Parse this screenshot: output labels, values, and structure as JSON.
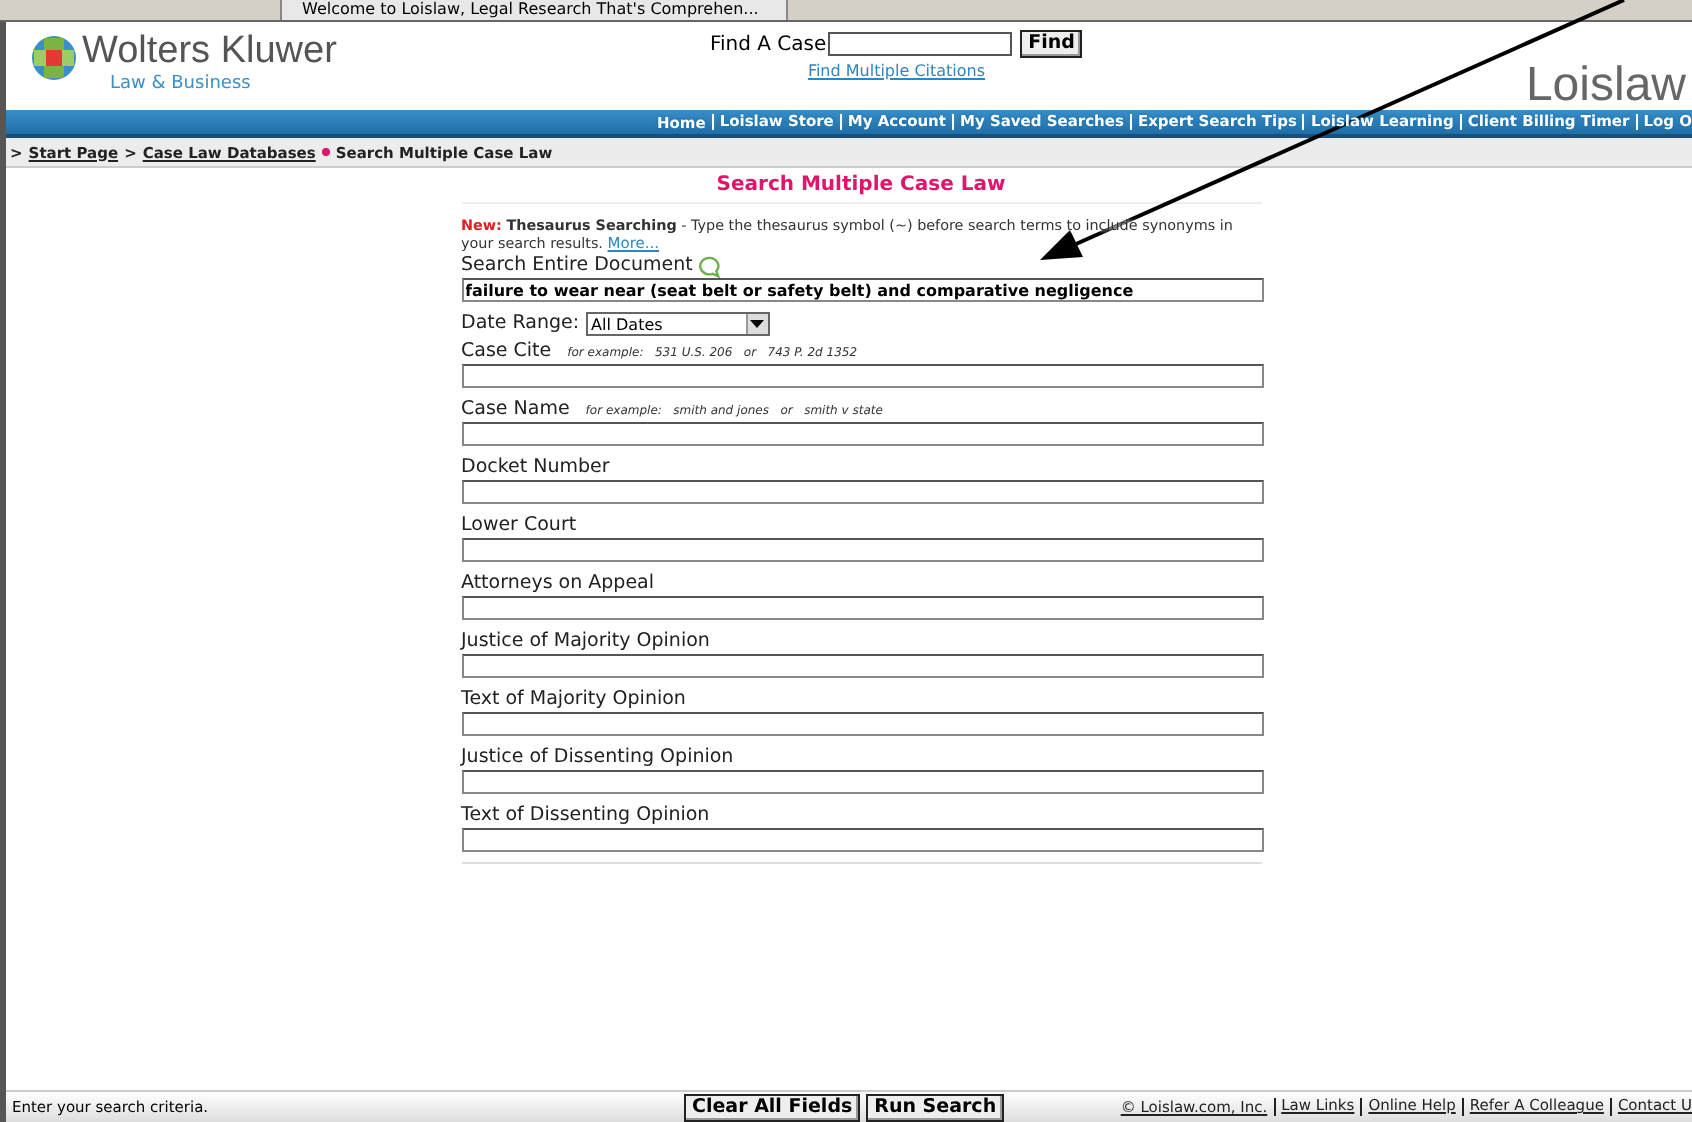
{
  "browser_tab": {
    "title": "Welcome to Loislaw, Legal Research That's Comprehen..."
  },
  "header": {
    "logo_name": "Wolters Kluwer",
    "logo_sub": "Law & Business",
    "find_label": "Find A Case",
    "find_button": "Find",
    "find_multiple": "Find Multiple Citations",
    "brand": "Loislaw"
  },
  "nav": [
    "Home",
    "Loislaw Store",
    "My Account",
    "My Saved Searches",
    "Expert Search Tips",
    "Loislaw Learning",
    "Client Billing Timer",
    "Log O"
  ],
  "breadcrumb": {
    "prefix": ">",
    "links": [
      "Start Page",
      "Case Law Databases"
    ],
    "current": "Search Multiple Case Law"
  },
  "page_title": "Search Multiple Case Law",
  "notice": {
    "new": "New:",
    "title": "Thesaurus Searching",
    "text": " - Type the thesaurus symbol (~) before search terms to include synonyms in your search results.",
    "more": "More..."
  },
  "fields": [
    {
      "kind": "text",
      "label": "Search Entire Document",
      "help_icon": true,
      "value": "failure to wear near (seat belt or safety belt) and comparative negligence"
    },
    {
      "kind": "select",
      "label": "Date Range:",
      "value": "All Dates"
    },
    {
      "kind": "text",
      "label": "Case Cite",
      "hint": "for example:   531 U.S. 206   or   743 P. 2d 1352"
    },
    {
      "kind": "text",
      "label": "Case Name",
      "hint": "for example:   smith and jones   or   smith v state"
    },
    {
      "kind": "text",
      "label": "Docket Number"
    },
    {
      "kind": "text",
      "label": "Lower Court"
    },
    {
      "kind": "text",
      "label": "Attorneys on Appeal"
    },
    {
      "kind": "text",
      "label": "Justice of Majority Opinion"
    },
    {
      "kind": "text",
      "label": "Text of Majority Opinion"
    },
    {
      "kind": "text",
      "label": "Justice of Dissenting Opinion"
    },
    {
      "kind": "text",
      "label": "Text of Dissenting Opinion"
    }
  ],
  "status_bar": {
    "message": "Enter your search criteria.",
    "buttons": [
      "Clear All Fields",
      "Run Search"
    ],
    "links": [
      "© Loislaw.com, Inc.",
      "Law Links",
      "Online Help",
      "Refer A Colleague",
      "Contact U"
    ]
  }
}
